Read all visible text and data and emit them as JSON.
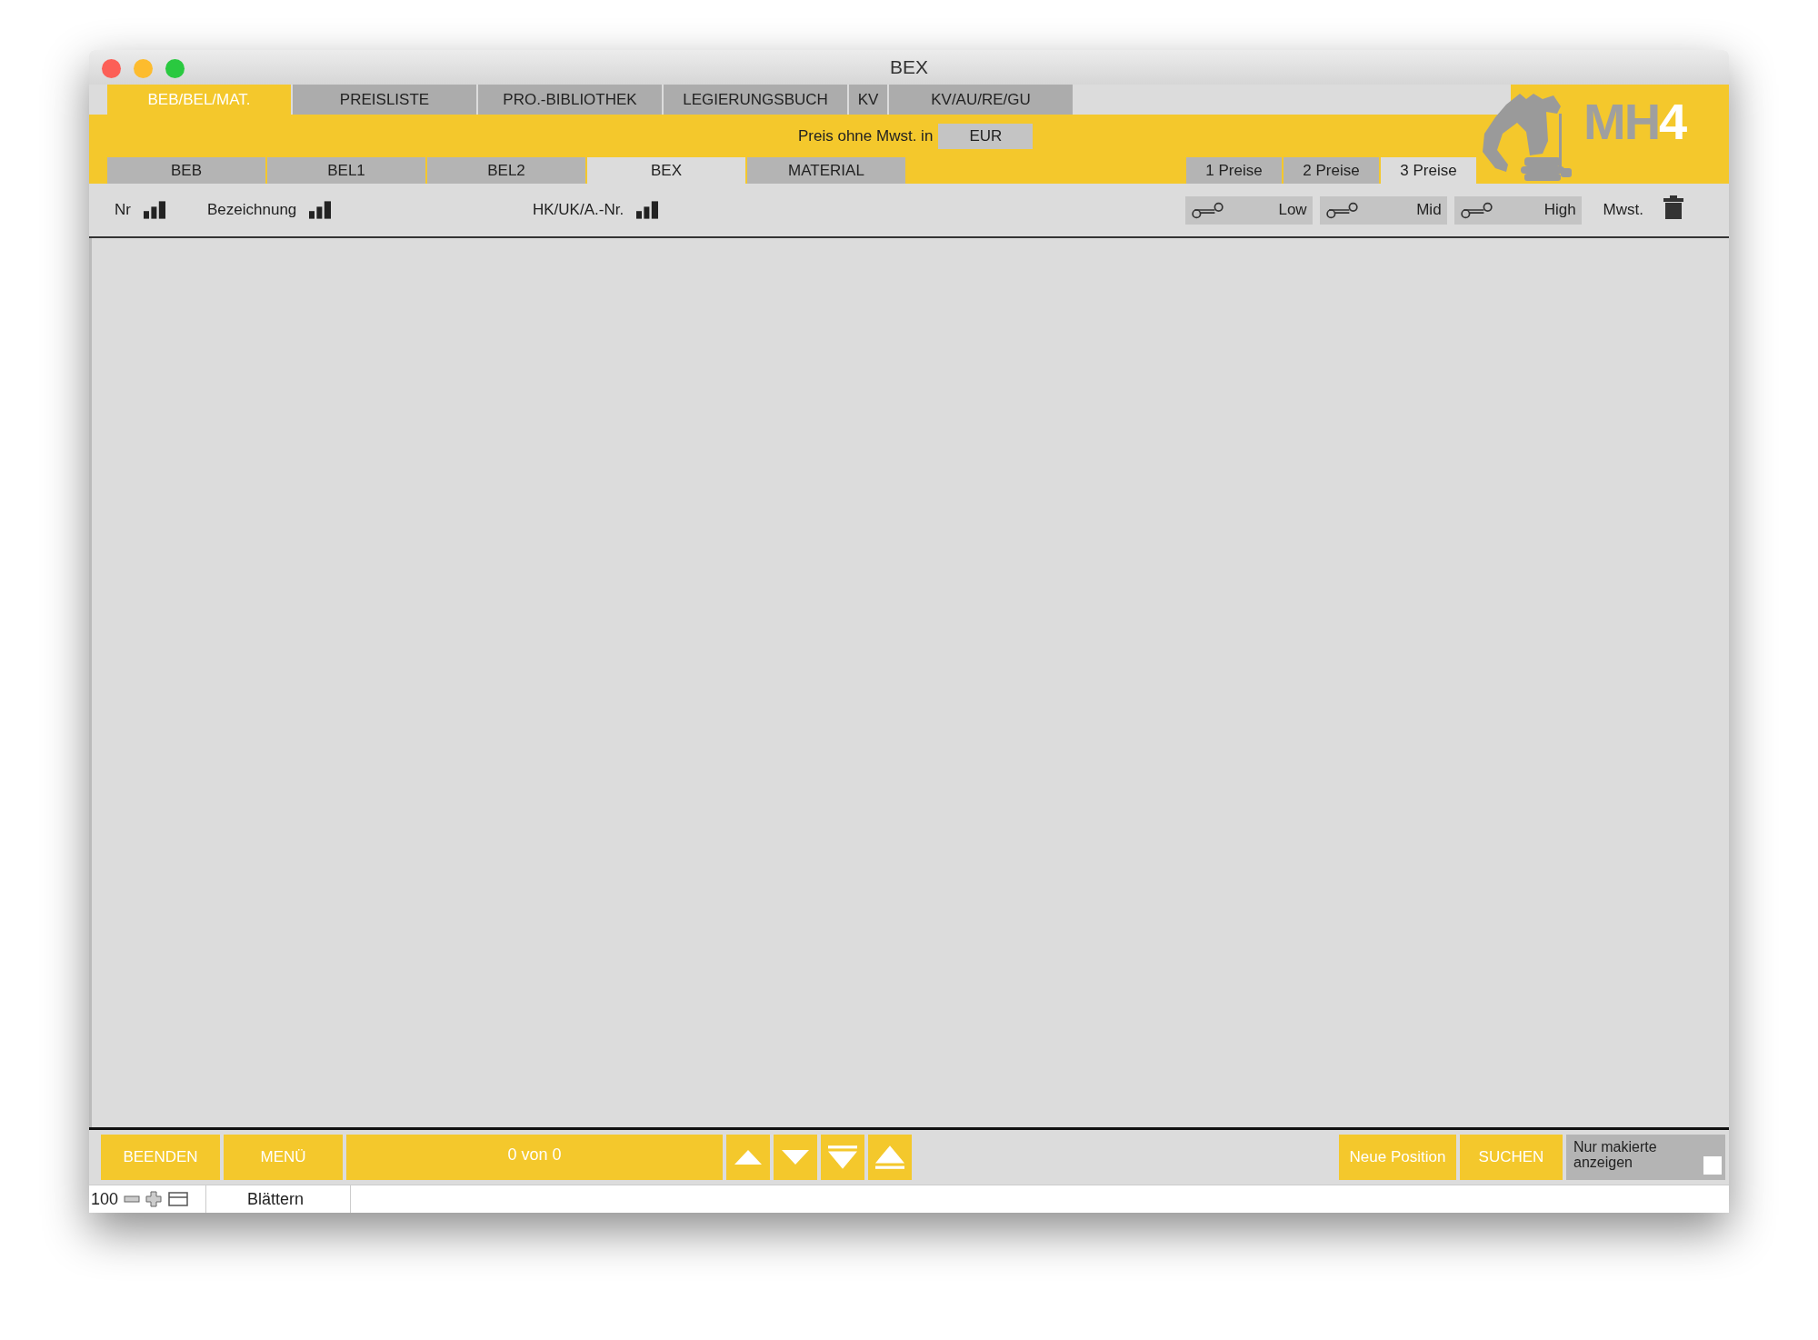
{
  "window": {
    "title": "BEX"
  },
  "main_tabs": [
    {
      "label": "BEB/BEL/MAT.",
      "selected": true
    },
    {
      "label": "PREISLISTE",
      "selected": false
    },
    {
      "label": "PRO.-BIBLIOTHEK",
      "selected": false
    },
    {
      "label": "LEGIERUNGSBUCH",
      "selected": false
    },
    {
      "label": "KV",
      "selected": false
    },
    {
      "label": "KV/AU/RE/GU",
      "selected": false
    }
  ],
  "logo": {
    "text": "MH4"
  },
  "currency": {
    "label": "Preis ohne Mwst. in",
    "value": "EUR"
  },
  "sub_tabs": [
    {
      "label": "BEB",
      "selected": false
    },
    {
      "label": "BEL1",
      "selected": false
    },
    {
      "label": "BEL2",
      "selected": false
    },
    {
      "label": "BEX",
      "selected": true
    },
    {
      "label": "MATERIAL",
      "selected": false
    }
  ],
  "price_tabs": [
    {
      "label": "1 Preise",
      "selected": false
    },
    {
      "label": "2 Preise",
      "selected": false
    },
    {
      "label": "3 Preise",
      "selected": true
    }
  ],
  "columns": [
    {
      "label": "Nr"
    },
    {
      "label": "Bezeichnung"
    },
    {
      "label": "HK/UK/A.-Nr."
    }
  ],
  "price_columns": [
    {
      "label": "Low"
    },
    {
      "label": "Mid"
    },
    {
      "label": "High"
    }
  ],
  "vat_column": {
    "label": "Mwst."
  },
  "bottom_bar": {
    "quit": "BEENDEN",
    "menu": "MENÜ",
    "record_count": "0 von 0",
    "nav": [
      {
        "kind": "up"
      },
      {
        "kind": "down"
      },
      {
        "kind": "last"
      },
      {
        "kind": "first"
      }
    ],
    "new_position": "Neue Position",
    "search": "SUCHEN",
    "filter": {
      "label": "Nur makierte anzeigen",
      "checked": false
    }
  },
  "status_bar": {
    "zoom": "100",
    "mode": "Blättern"
  }
}
